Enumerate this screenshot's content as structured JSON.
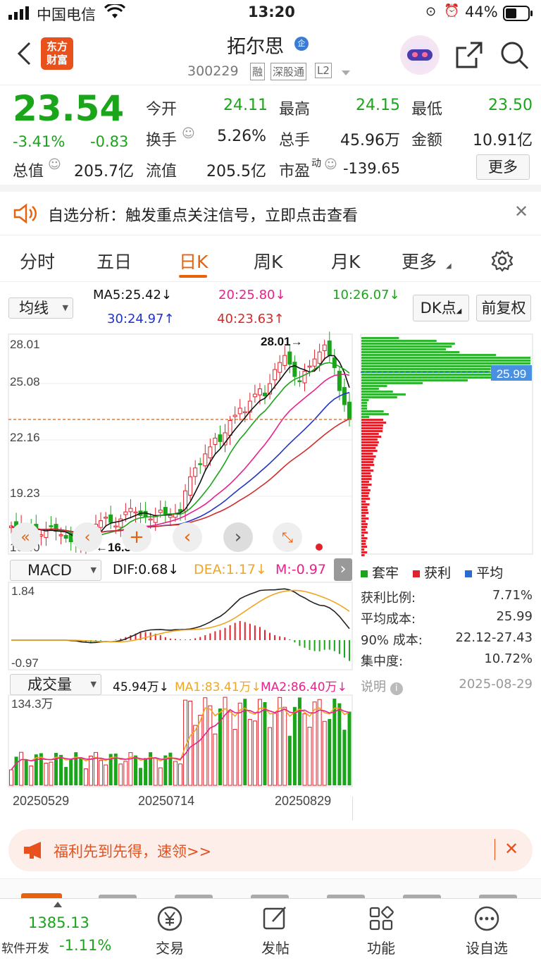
{
  "status_bar": {
    "carrier": "中国电信",
    "time": "13:20",
    "battery": "44%"
  },
  "header": {
    "brand_line1": "东方",
    "brand_line2": "财富",
    "stock_name": "拓尔思",
    "badge": "企",
    "stock_code": "300229",
    "tags": [
      "融",
      "深股通",
      "L2"
    ]
  },
  "quote": {
    "price": "23.54",
    "change_pct": "-3.41%",
    "change": "-0.83",
    "open_label": "今开",
    "open": "24.11",
    "high_label": "最高",
    "high": "24.15",
    "low_label": "最低",
    "low": "23.50",
    "turnover_label": "换手",
    "turnover": "5.26%",
    "volume_label": "总手",
    "volume": "45.96万",
    "amount_label": "金额",
    "amount": "10.91亿",
    "mktcap_label": "总值",
    "mktcap": "205.7亿",
    "float_label": "流值",
    "float": "205.5亿",
    "pe_label": "市盈",
    "pe_sup": "动",
    "pe": "-139.65",
    "more": "更多"
  },
  "notice": {
    "text": "自选分析：触发重点关注信号，立即点击查看"
  },
  "tabs": [
    "分时",
    "五日",
    "日K",
    "周K",
    "月K",
    "更多"
  ],
  "toolbar": {
    "ma_select": "均线",
    "ma5": "MA5:25.42↓",
    "ma20": "20:25.80↓",
    "ma10": "10:26.07↓",
    "ma30": "30:24.97↑",
    "ma40": "40:23.63↑",
    "dk": "DK点",
    "adjust": "前复权"
  },
  "kline": {
    "y_labels": [
      "28.01",
      "25.08",
      "22.16",
      "19.23",
      "16.30"
    ],
    "high_mark": "28.01→",
    "low_mark": "←16.30",
    "cost_price": "25.99"
  },
  "colors": {
    "up": "#e0222c",
    "down": "#1aa51a",
    "ma5": "#111111",
    "ma10": "#1aa51a",
    "ma20": "#e8218c",
    "ma30": "#2233cc",
    "ma40": "#d12c2c",
    "accent": "#e8620c"
  },
  "macd": {
    "select": "MACD",
    "dif": "DIF:0.68↓",
    "dea": "DEA:1.17↓",
    "m": "M:-0.97",
    "y_top": "1.84",
    "y_bottom": "-0.97"
  },
  "chips": {
    "legend": [
      "套牢",
      "获利",
      "平均"
    ],
    "rows": [
      {
        "label": "获利比例:",
        "value": "7.71%"
      },
      {
        "label": "平均成本:",
        "value": "25.99"
      },
      {
        "label": "90% 成本:",
        "value": "22.12-27.43"
      },
      {
        "label": "集中度:",
        "value": "10.72%"
      }
    ],
    "note_label": "说明",
    "date": "2025-08-29"
  },
  "volume": {
    "select": "成交量",
    "vol": "45.94万↓",
    "ma1": "MA1:83.41万↓",
    "ma2": "MA2:86.40万↓",
    "y_top": "134.3万",
    "dates": [
      "20250529",
      "20250714",
      "20250829"
    ]
  },
  "ad": {
    "text": "福利先到先得，速领>>"
  },
  "bottom_nav": {
    "index_value": "1385.13",
    "index_name": "软件开发",
    "index_change": "-1.11%",
    "items": [
      "交易",
      "发帖",
      "功能",
      "设自选"
    ]
  },
  "chart_data": {
    "type": "candlestick",
    "ylim": [
      16.3,
      28.01
    ],
    "close_approx": [
      17.5,
      17.2,
      17.6,
      17.3,
      17.4,
      17.1,
      17.0,
      17.3,
      17.5,
      17.2,
      17.0,
      16.8,
      16.6,
      16.5,
      16.3,
      16.9,
      17.2,
      17.6,
      17.8,
      18.0,
      17.7,
      17.5,
      17.9,
      18.3,
      18.5,
      18.3,
      18.1,
      18.0,
      17.9,
      18.1,
      18.4,
      18.2,
      18.1,
      18.2,
      18.3,
      19.5,
      20.3,
      20.8,
      21.0,
      21.6,
      22.0,
      22.5,
      22.3,
      22.8,
      23.5,
      23.8,
      24.2,
      24.0,
      24.6,
      25.0,
      25.3,
      24.9,
      25.6,
      26.4,
      26.8,
      27.2,
      26.7,
      26.0,
      25.7,
      26.3,
      26.6,
      27.0,
      27.4,
      27.8,
      27.2,
      26.5,
      25.2,
      24.4,
      23.54
    ],
    "chip_avg_cost": 25.99
  }
}
